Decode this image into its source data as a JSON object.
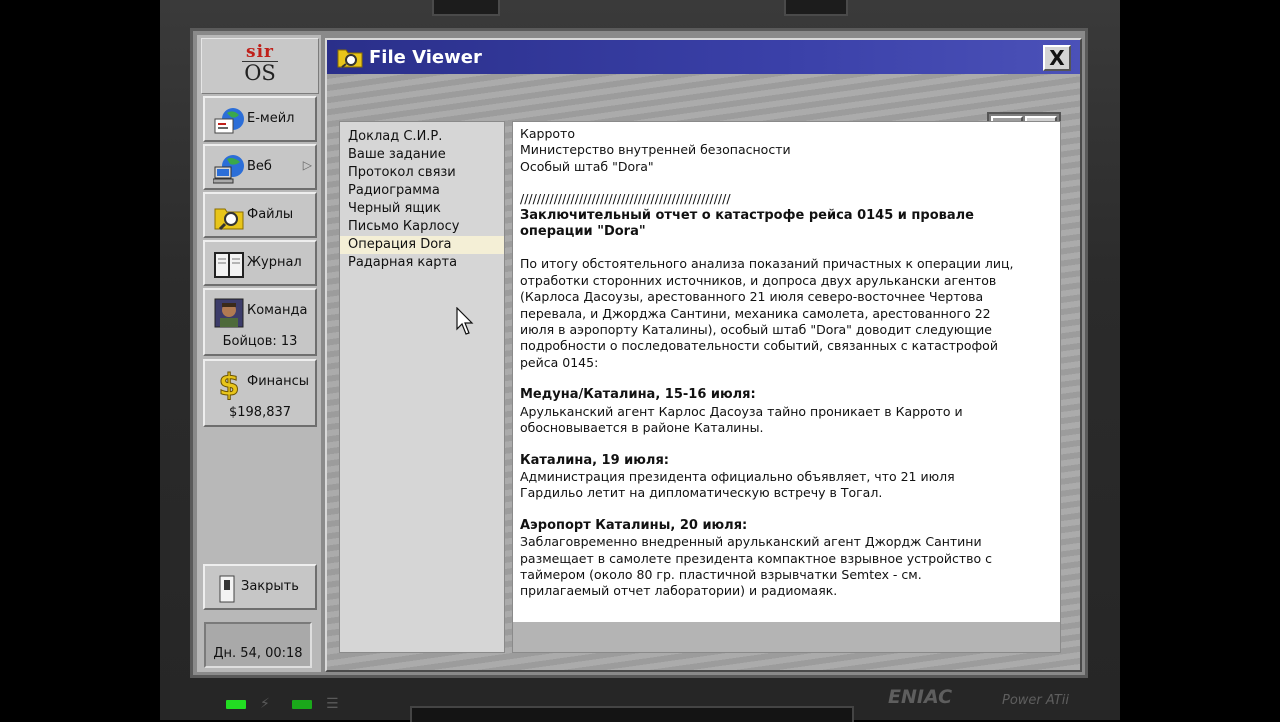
{
  "app": {
    "logo_top": "sir",
    "logo_bottom": "OS",
    "window_title": "File Viewer",
    "close_label": "X"
  },
  "sidebar": {
    "email_label": "Е-мейл",
    "web_label": "Веб",
    "files_label": "Файлы",
    "journal_label": "Журнал",
    "team_label": "Команда",
    "team_sub": "Бойцов: 13",
    "finance_label": "Финансы",
    "finance_sub": "$198,837",
    "close_label": "Закрыть",
    "status_time": "Дн. 54, 00:18"
  },
  "documents": {
    "items": [
      {
        "label": "Доклад С.И.Р."
      },
      {
        "label": "Ваше задание"
      },
      {
        "label": "Протокол связи"
      },
      {
        "label": "Радиограмма"
      },
      {
        "label": "Черный ящик"
      },
      {
        "label": "Письмо Карлосу"
      },
      {
        "label": "Операция Dora"
      },
      {
        "label": "Радарная карта"
      }
    ],
    "selected_index": 6
  },
  "document": {
    "h1": "Каррото",
    "h2": "Министерство внутренней безопасности",
    "h3": "Особый штаб \"Dora\"",
    "divider": "//////////////////////////////////////////////////",
    "title_line1": "Заключительный отчет о катастрофе рейса 0145 и провале",
    "title_line2": "операции \"Dora\"",
    "intro_1": "По итогу обстоятельного анализа показаний причастных к операции лиц,",
    "intro_2": "отработки сторонних источников, и допроса двух арулькански агентов",
    "intro_3": "(Карлоса Дасоузы, арестованного 21 июля северо-восточнее Чертова",
    "intro_4": "перевала, и Джорджа Сантини, механика самолета, арестованного 22",
    "intro_5": "июля в аэропорту Каталины), особый штаб \"Dora\" доводит следующие",
    "intro_6": "подробности о последовательности событий, связанных с катастрофой",
    "intro_7": "рейса 0145:",
    "s1_head": "Медуна/Каталина, 15-16 июля:",
    "s1_1": "Арульканский агент Карлос Дасоуза тайно проникает в Каррото и",
    "s1_2": "обосновывается в районе Каталины.",
    "s2_head": "Каталина, 19 июля:",
    "s2_1": "Администрация президента официально объявляет, что 21 июля",
    "s2_2": "Гардильо летит на дипломатическую встречу в Тогал.",
    "s3_head": "Аэропорт Каталины, 20 июля:",
    "s3_1": "Заблаговременно внедренный арульканский агент Джордж Сантини",
    "s3_2": "размещает в самолете президента компактное взрывное устройство с",
    "s3_3": "таймером (около 80 гр. пластичной взрывчатки Semtex - см.",
    "s3_4": "прилагаемый отчет лаборатории) и радиомаяк."
  },
  "bezel": {
    "brand": "ENIAC",
    "brand_sub": "Power ATii"
  },
  "colors": {
    "titlebar": "#3a40a8",
    "logo_red": "#c0201a",
    "selected_item": "#f4efd6",
    "led_green": "#22dd22"
  }
}
